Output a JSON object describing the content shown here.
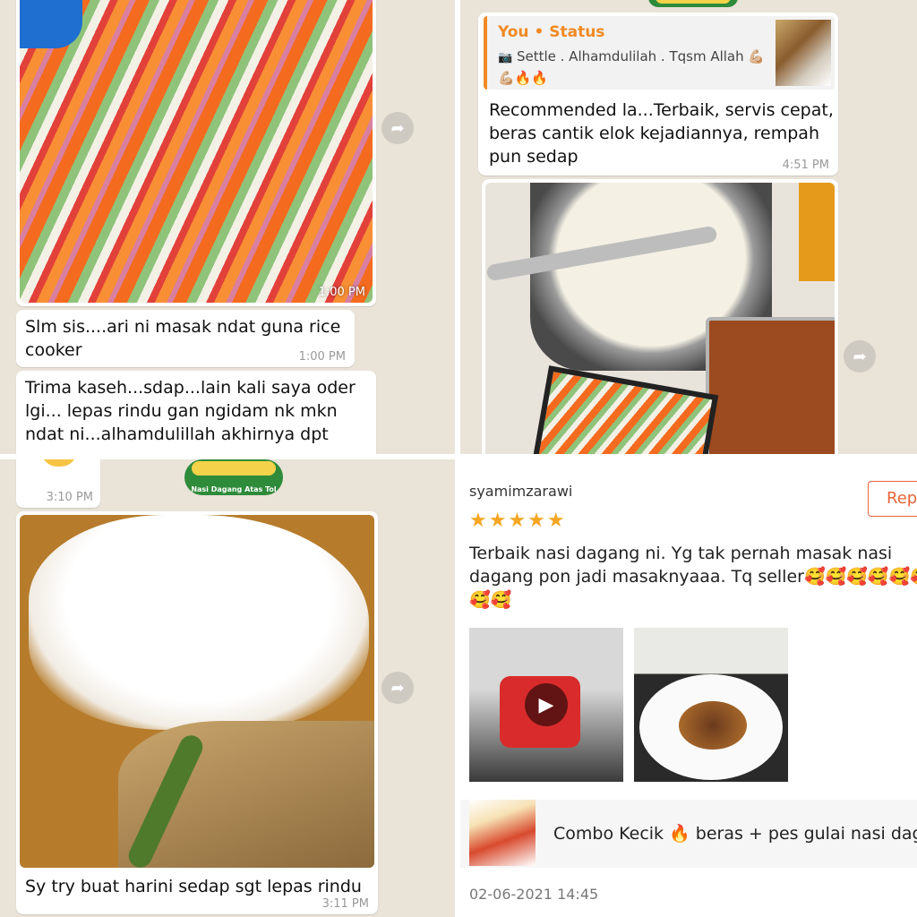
{
  "chat_top_left": {
    "photo_time": "1:00 PM",
    "msg1": "Slm sis....ari ni masak ndat guna rice cooker",
    "msg1_time": "1:00 PM",
    "msg2": "Trima kaseh...sdap...lain kali saya oder lgi... lepas rindu gan ngidam nk mkn ndat ni...alhamdulillah akhirnya dpt"
  },
  "chat_top_right": {
    "reply_sender": "You • Status",
    "reply_text": "Settle . Alhamdulilah . Tqsm Allah 💪🏼 💪🏼🔥🔥",
    "msg": "Recommended la...Terbaik, servis cepat, beras cantik elok kejadiannya, rempah pun sedap",
    "msg_time": "4:51 PM"
  },
  "chat_bottom_left": {
    "top_time": "3:10 PM",
    "logo_text": "Nasi Dagang Atas Tol",
    "msg": "Sy try buat harini sedap sgt lepas rindu",
    "msg_time": "3:11 PM"
  },
  "review": {
    "username": "syamimzarawi",
    "reply_label": "Rep",
    "stars": "★★★★★",
    "rating": 5,
    "text": "Terbaik nasi dagang ni. Yg tak pernah masak nasi dagang pon jadi masaknyaaa. Tq seller🥰🥰🥰🥰🥰🥰🥰🥰",
    "product": "Combo Kecik 🔥 beras + pes gulai nasi dagang",
    "date": "02-06-2021 14:45"
  },
  "icons": {
    "forward": "forward-arrow-icon",
    "camera": "camera-icon",
    "play": "play-icon"
  },
  "colors": {
    "accent_orange": "#f08a24",
    "star": "#f5a623",
    "reply_border": "#e8663a"
  }
}
